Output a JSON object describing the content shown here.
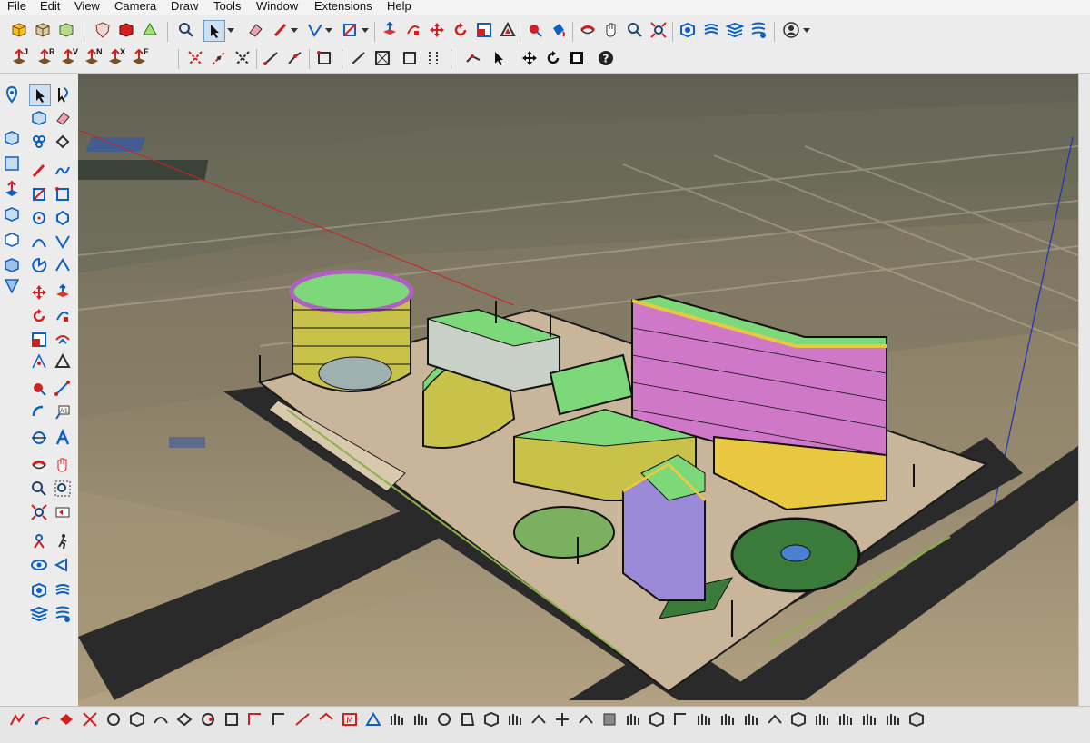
{
  "menu": [
    "File",
    "Edit",
    "View",
    "Camera",
    "Draw",
    "Tools",
    "Window",
    "Extensions",
    "Help"
  ],
  "toolbar1": {
    "icons": [
      "component-icon",
      "package-icon",
      "box-icon",
      "shield-icon",
      "warehouse-icon",
      "recycle-icon",
      "zoom-icon",
      "select-arrow-icon",
      "dropdown-arrow-icon",
      "eraser-icon",
      "pencil-icon",
      "dropdown-arrow-icon",
      "line-icon",
      "dropdown-arrow-icon",
      "rectangle-icon",
      "dropdown-arrow-icon",
      "push-pull-icon",
      "follow-me-icon",
      "move-icon",
      "rotate-icon",
      "scale-icon",
      "offset-icon",
      "tape-measure-icon",
      "paint-bucket-icon",
      "orbit-icon",
      "pan-icon",
      "zoom-window-icon",
      "zoom-extents-icon",
      "geo-location-icon",
      "sandbox-icon",
      "layers-icon",
      "outliner-icon",
      "user-account-icon",
      "dropdown-arrow-icon"
    ]
  },
  "toolbar2": {
    "label_buttons": [
      "J",
      "R",
      "V",
      "N",
      "X",
      "F"
    ]
  },
  "left_tools": [
    "location-pin-icon",
    "section-plane-icon",
    "section-fill-icon",
    "3d-warehouse-icon",
    "extension-icon",
    "solid-tools-icon",
    "styles-icon",
    "geometry-icon"
  ],
  "viewport": {
    "description_colors": {
      "building_roof": "#7dd87a",
      "building_wall": "#c8c24a",
      "accent_purple": "#b060c0",
      "road": "#2a2a2a",
      "plaza": "#c9b59a",
      "red_axis": "#d02020",
      "blue_axis": "#2030c0"
    }
  }
}
